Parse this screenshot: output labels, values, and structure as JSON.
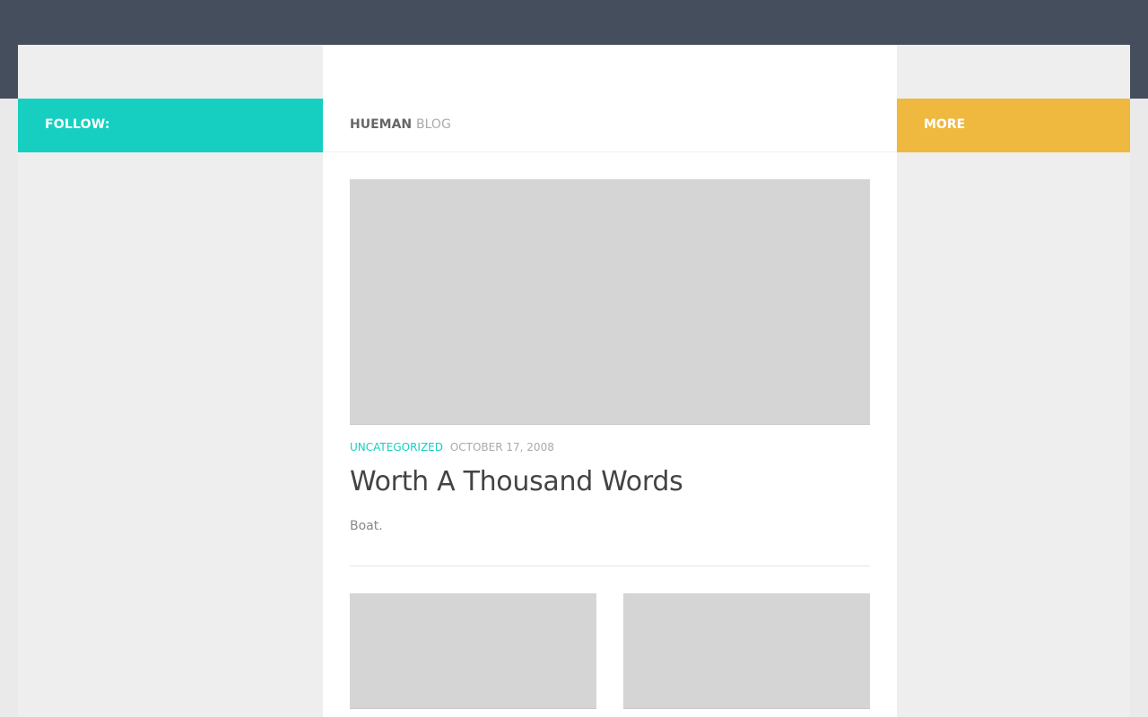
{
  "colors": {
    "topbar": "#454e5c",
    "follow_bg": "#16cfc1",
    "more_bg": "#efb93f",
    "accent": "#16cfc1"
  },
  "sidebar_left": {
    "heading": "FOLLOW:"
  },
  "page_title": {
    "site": "HUEMAN",
    "section": "BLOG"
  },
  "post": {
    "category": "UNCATEGORIZED",
    "date": "OCTOBER 17, 2008",
    "title": "Worth A Thousand Words",
    "excerpt": "Boat."
  },
  "sidebar_right": {
    "heading": "MORE"
  }
}
